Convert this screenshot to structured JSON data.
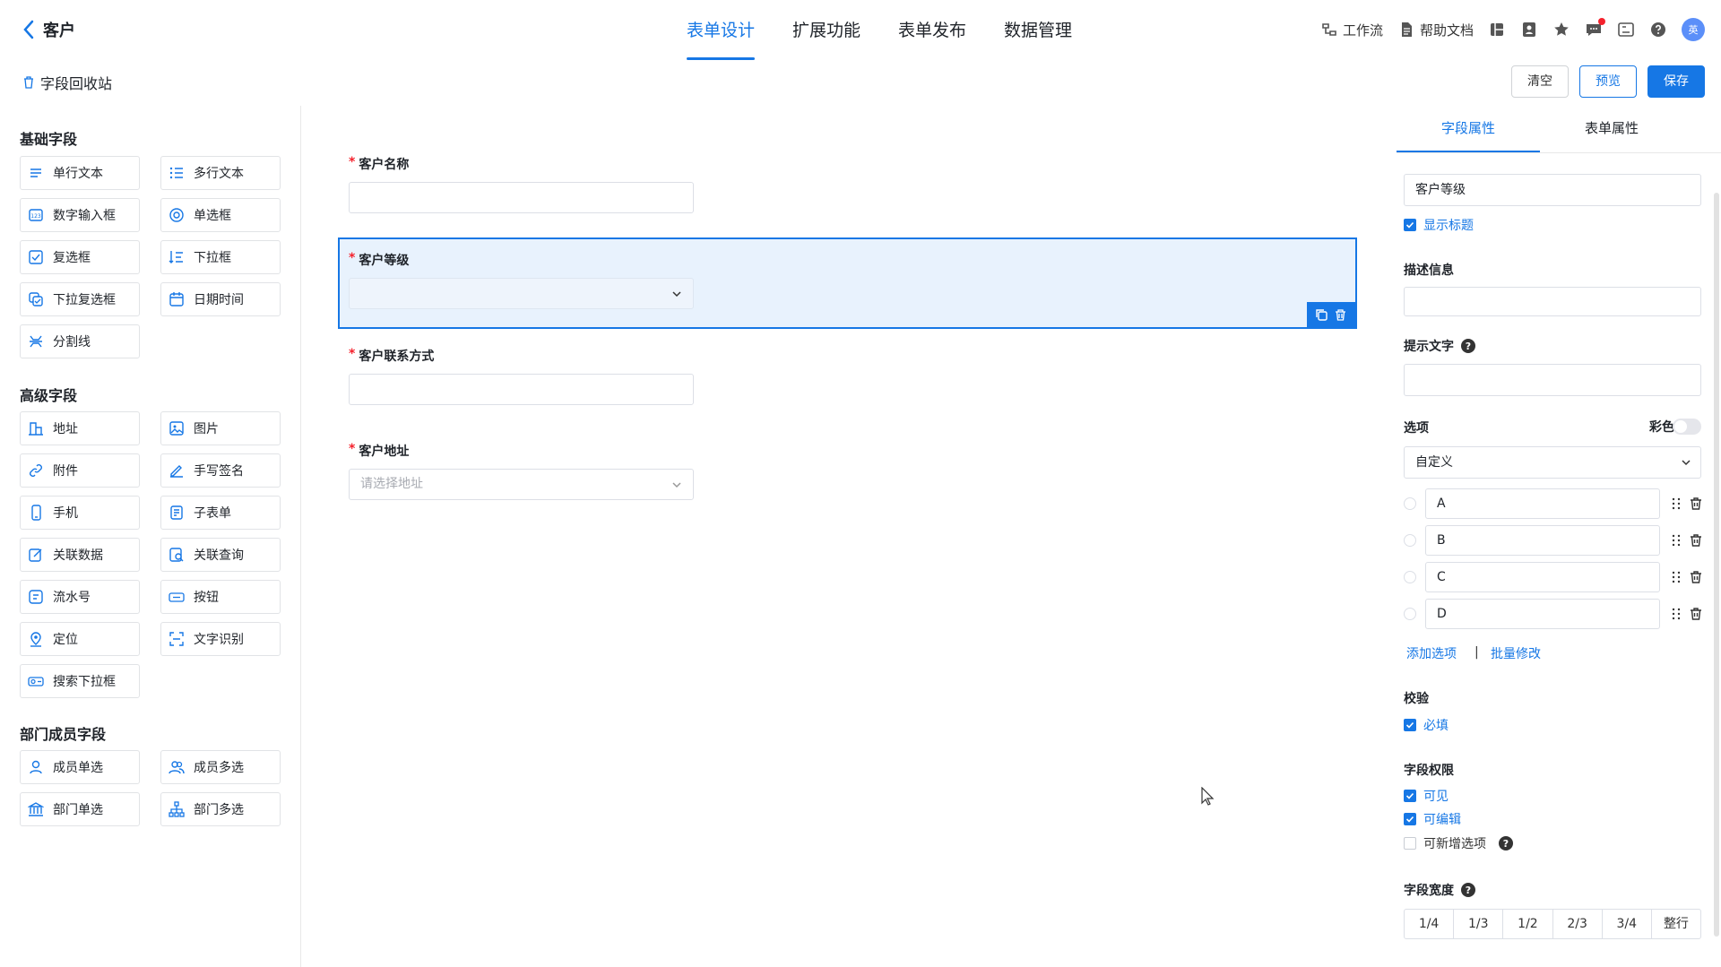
{
  "header": {
    "back_label": "客户",
    "tabs": [
      {
        "label": "表单设计",
        "active": true
      },
      {
        "label": "扩展功能",
        "active": false
      },
      {
        "label": "表单发布",
        "active": false
      },
      {
        "label": "数据管理",
        "active": false
      }
    ],
    "workflow_label": "工作流",
    "help_doc_label": "帮助文档",
    "avatar_text": "英"
  },
  "toolbar": {
    "recycle_label": "字段回收站",
    "clear_label": "清空",
    "preview_label": "预览",
    "save_label": "保存"
  },
  "left_panel": {
    "basic_title": "基础字段",
    "basic": [
      "单行文本",
      "多行文本",
      "数字输入框",
      "单选框",
      "复选框",
      "下拉框",
      "下拉复选框",
      "日期时间",
      "分割线"
    ],
    "advanced_title": "高级字段",
    "advanced": [
      "地址",
      "图片",
      "附件",
      "手写签名",
      "手机",
      "子表单",
      "关联数据",
      "关联查询",
      "流水号",
      "按钮",
      "定位",
      "文字识别",
      "搜索下拉框"
    ],
    "member_title": "部门成员字段",
    "member": [
      "成员单选",
      "成员多选",
      "部门单选",
      "部门多选"
    ]
  },
  "form": {
    "fields": [
      {
        "label": "客户名称",
        "value": ""
      },
      {
        "label": "客户等级",
        "value": ""
      },
      {
        "label": "客户联系方式",
        "value": ""
      },
      {
        "label": "客户地址",
        "placeholder": "请选择地址"
      }
    ]
  },
  "right_panel": {
    "tab_field": "字段属性",
    "tab_form": "表单属性",
    "title_value": "客户等级",
    "show_title": "显示标题",
    "desc_label": "描述信息",
    "hint_label": "提示文字",
    "options_label": "选项",
    "color_label": "彩色",
    "options_source": "自定义",
    "options": [
      "A",
      "B",
      "C",
      "D"
    ],
    "add_option": "添加选项",
    "separator": "|",
    "batch_edit": "批量修改",
    "validate_label": "校验",
    "required": "必填",
    "perm_label": "字段权限",
    "visible": "可见",
    "editable": "可编辑",
    "can_add_option": "可新增选项",
    "width_label": "字段宽度",
    "widths": [
      "1/4",
      "1/3",
      "1/2",
      "2/3",
      "3/4",
      "整行"
    ],
    "help_mark": "?"
  },
  "colors": {
    "accent": "#1677e5",
    "required": "#f5222d",
    "selected_bg": "#e8f2fd"
  }
}
